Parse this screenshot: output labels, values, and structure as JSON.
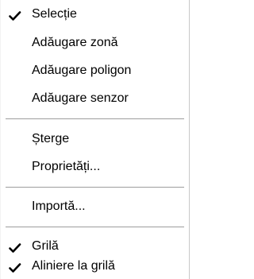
{
  "menu": {
    "selection": {
      "label": "Selecție",
      "checked": true
    },
    "add_zone": {
      "label": "Adăugare zonă"
    },
    "add_polygon": {
      "label": "Adăugare poligon"
    },
    "add_sensor": {
      "label": "Adăugare senzor"
    },
    "delete": {
      "label": "Șterge"
    },
    "properties": {
      "label": "Proprietăți..."
    },
    "import": {
      "label": "Importă..."
    },
    "grid": {
      "label": "Grilă",
      "checked": true
    },
    "snap_to_grid": {
      "label": "Aliniere la grilă",
      "checked": true
    }
  },
  "icons": {
    "check": "check-icon"
  }
}
